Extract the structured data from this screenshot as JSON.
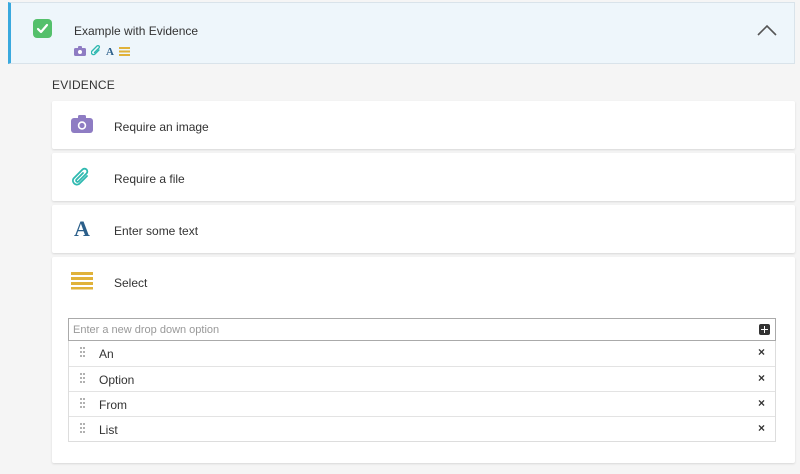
{
  "header": {
    "title": "Example with Evidence",
    "checked": true,
    "mini_icons": [
      "camera-icon",
      "paperclip-icon",
      "text-a-icon",
      "list-icon"
    ],
    "collapse_icon": "chevron-up-icon"
  },
  "section_label": "EVIDENCE",
  "evidence": [
    {
      "label": "Require an image",
      "icon": "camera-icon",
      "color": "#8e7cc3"
    },
    {
      "label": "Require a file",
      "icon": "paperclip-icon",
      "color": "#2fb9b0"
    },
    {
      "label": "Enter some text",
      "icon": "text-a-icon",
      "color": "#2b5f8a"
    },
    {
      "label": "Select",
      "icon": "list-icon",
      "color": "#e0b23a"
    }
  ],
  "dropdown": {
    "placeholder": "Enter a new drop down option",
    "value": "",
    "options": [
      "An",
      "Option",
      "From",
      "List"
    ]
  },
  "colors": {
    "accent": "#3aa9de",
    "check": "#54c06b",
    "header_bg": "#eef6fb"
  }
}
